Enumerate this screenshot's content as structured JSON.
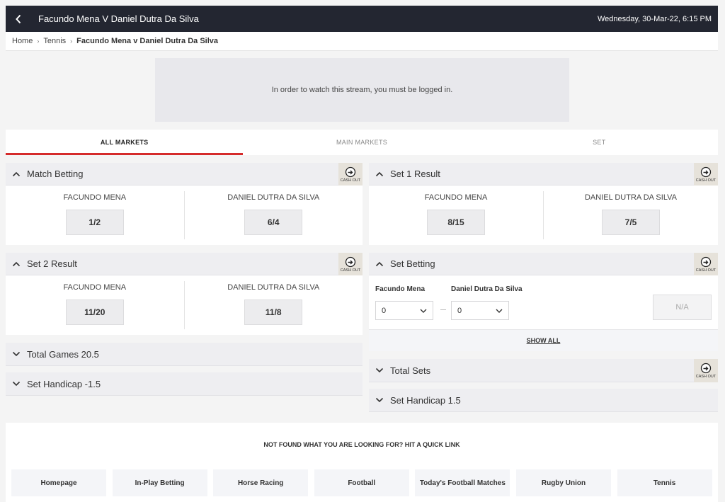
{
  "header": {
    "title": "Facundo Mena V Daniel Dutra Da Silva",
    "datetime": "Wednesday, 30-Mar-22, 6:15 PM"
  },
  "breadcrumb": {
    "home": "Home",
    "sport": "Tennis",
    "current": "Facundo Mena v Daniel Dutra Da Silva"
  },
  "stream": {
    "message": "In order to watch this stream, you must be logged in."
  },
  "tabs": [
    {
      "label": "ALL MARKETS",
      "active": true
    },
    {
      "label": "MAIN MARKETS",
      "active": false
    },
    {
      "label": "SET",
      "active": false
    }
  ],
  "cashout_label": "CASH OUT",
  "markets": {
    "match_betting": {
      "title": "Match Betting",
      "selections": [
        {
          "name": "FACUNDO MENA",
          "odds": "1/2"
        },
        {
          "name": "DANIEL DUTRA DA SILVA",
          "odds": "6/4"
        }
      ]
    },
    "set1_result": {
      "title": "Set 1 Result",
      "selections": [
        {
          "name": "FACUNDO MENA",
          "odds": "8/15"
        },
        {
          "name": "DANIEL DUTRA DA SILVA",
          "odds": "7/5"
        }
      ]
    },
    "set2_result": {
      "title": "Set 2 Result",
      "selections": [
        {
          "name": "FACUNDO MENA",
          "odds": "11/20"
        },
        {
          "name": "DANIEL DUTRA DA SILVA",
          "odds": "11/8"
        }
      ]
    },
    "set_betting": {
      "title": "Set Betting",
      "player1": "Facundo Mena",
      "player2": "Daniel Dutra Da Silva",
      "select1_value": "0",
      "select2_value": "0",
      "odds": "N/A",
      "show_all": "SHOW ALL"
    },
    "total_games": {
      "title": "Total Games 20.5"
    },
    "set_handicap_neg": {
      "title": "Set Handicap -1.5"
    },
    "total_sets": {
      "title": "Total Sets"
    },
    "set_handicap_pos": {
      "title": "Set Handicap 1.5"
    }
  },
  "quick_links": {
    "title": "NOT FOUND WHAT YOU ARE LOOKING FOR? HIT A QUICK LINK",
    "links": [
      "Homepage",
      "In-Play Betting",
      "Horse Racing",
      "Football",
      "Today's Football Matches",
      "Rugby Union",
      "Tennis"
    ]
  }
}
